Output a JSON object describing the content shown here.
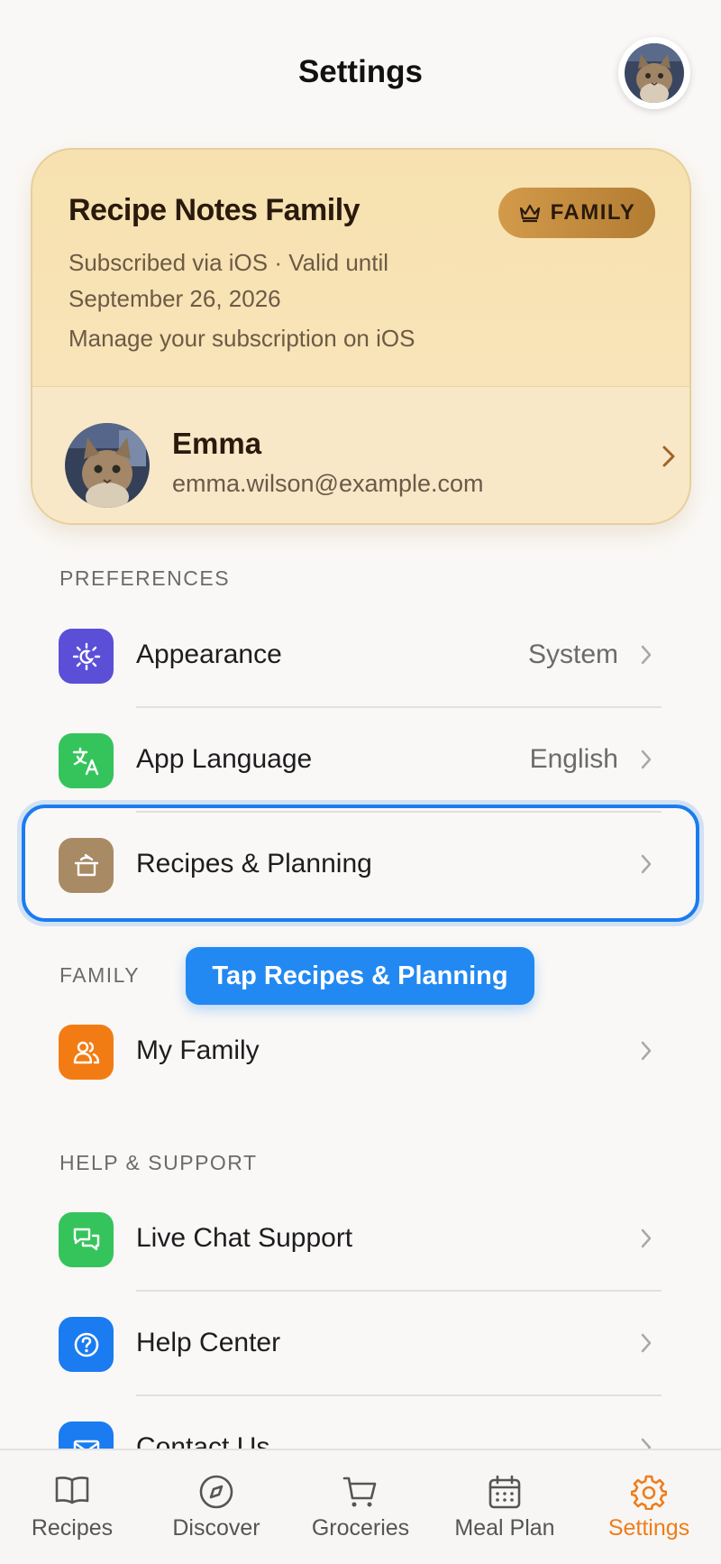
{
  "header": {
    "title": "Settings",
    "avatar_icon": "cat-avatar-icon"
  },
  "subscription": {
    "name": "Recipe Notes Family",
    "badge_label": "FAMILY",
    "badge_icon": "crown-icon",
    "line1": "Subscribed via iOS · Valid until",
    "line2": "September 26, 2026",
    "manage": "Manage your subscription on iOS",
    "user": {
      "name": "Emma",
      "email": "emma.wilson@example.com"
    }
  },
  "preferences": {
    "label": "PREFERENCES",
    "items": [
      {
        "label": "Appearance",
        "value": "System",
        "icon": "appearance-icon",
        "color": "#5b4fd8"
      },
      {
        "label": "App Language",
        "value": "English",
        "icon": "translate-icon",
        "color": "#35c45c"
      },
      {
        "label": "Recipes & Planning",
        "value": "",
        "icon": "cooking-pot-icon",
        "color": "#a88a64"
      }
    ]
  },
  "tooltip": "Tap Recipes & Planning",
  "family": {
    "label": "FAMILY",
    "items": [
      {
        "label": "My Family",
        "value": "",
        "icon": "people-icon",
        "color": "#f27c13"
      }
    ]
  },
  "help": {
    "label": "HELP & SUPPORT",
    "items": [
      {
        "label": "Live Chat Support",
        "value": "",
        "icon": "chat-icon",
        "color": "#35c45c"
      },
      {
        "label": "Help Center",
        "value": "",
        "icon": "question-icon",
        "color": "#1a7cf0"
      },
      {
        "label": "Contact Us",
        "value": "",
        "icon": "mail-icon",
        "color": "#1a7cf0"
      }
    ]
  },
  "tabs": [
    {
      "label": "Recipes",
      "icon": "book-icon",
      "active": false
    },
    {
      "label": "Discover",
      "icon": "compass-icon",
      "active": false
    },
    {
      "label": "Groceries",
      "icon": "cart-icon",
      "active": false
    },
    {
      "label": "Meal Plan",
      "icon": "calendar-icon",
      "active": false
    },
    {
      "label": "Settings",
      "icon": "gear-icon",
      "active": true
    }
  ],
  "colors": {
    "accent": "#ef7d1a",
    "highlight": "#1a7cf0",
    "card": "#f7e1b0"
  }
}
